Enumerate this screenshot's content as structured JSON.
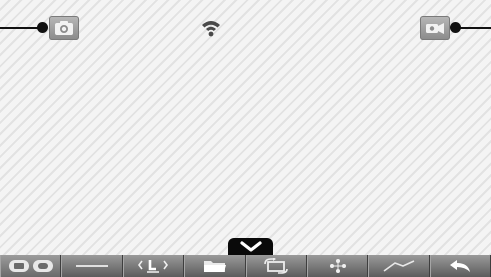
{
  "screen": {
    "top_left_button": {
      "icon": "camera-icon"
    },
    "status_indicator": {
      "icon": "wifi-icon"
    },
    "top_right_button": {
      "icon": "camera-switch-icon"
    },
    "collapse_tab": {
      "icon": "chevron-down-icon"
    }
  },
  "toolbar": {
    "tools": [
      {
        "name": "display-mode",
        "icon": "dual-screen-icon"
      },
      {
        "name": "line",
        "icon": "line-icon"
      },
      {
        "name": "l-shape",
        "icon": "l-shape-icon"
      },
      {
        "name": "folder",
        "icon": "folder-icon"
      },
      {
        "name": "rotate",
        "icon": "rotate-icon"
      },
      {
        "name": "dots",
        "icon": "dots-icon"
      },
      {
        "name": "curve",
        "icon": "curve-icon"
      },
      {
        "name": "back",
        "icon": "back-icon"
      }
    ]
  }
}
